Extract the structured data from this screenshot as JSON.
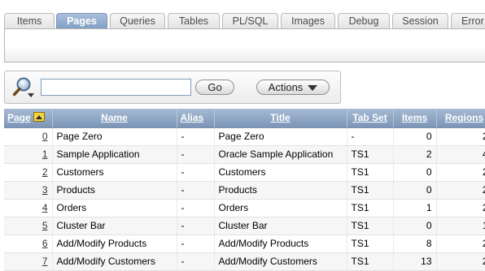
{
  "tabs": [
    {
      "label": "Items",
      "active": false
    },
    {
      "label": "Pages",
      "active": true
    },
    {
      "label": "Queries",
      "active": false
    },
    {
      "label": "Tables",
      "active": false
    },
    {
      "label": "PL/SQL",
      "active": false
    },
    {
      "label": "Images",
      "active": false
    },
    {
      "label": "Debug",
      "active": false
    },
    {
      "label": "Session",
      "active": false
    },
    {
      "label": "Error",
      "active": false
    }
  ],
  "search": {
    "value": "",
    "go_label": "Go",
    "actions_label": "Actions"
  },
  "icons": {
    "search": "magnifier-with-dropdown-icon",
    "sort": "sort-ascending-icon",
    "actions_caret": "chevron-down-icon"
  },
  "colors": {
    "header_bg": "#8ba3c3",
    "active_tab": "#8fa9cc",
    "sort_icon": "#f2d43a"
  },
  "report": {
    "columns": [
      "Page",
      "Name",
      "Alias",
      "Title",
      "Tab Set",
      "Items",
      "Regions"
    ],
    "rows": [
      [
        "0",
        "Page Zero",
        "-",
        "Page Zero",
        "-",
        "0",
        "2"
      ],
      [
        "1",
        "Sample Application",
        "-",
        "Oracle Sample Application",
        "TS1",
        "2",
        "4"
      ],
      [
        "2",
        "Customers",
        "-",
        "Customers",
        "TS1",
        "0",
        "2"
      ],
      [
        "3",
        "Products",
        "-",
        "Products",
        "TS1",
        "0",
        "2"
      ],
      [
        "4",
        "Orders",
        "-",
        "Orders",
        "TS1",
        "1",
        "2"
      ],
      [
        "5",
        "Cluster Bar",
        "-",
        "Cluster Bar",
        "TS1",
        "0",
        "1"
      ],
      [
        "6",
        "Add/Modify Products",
        "-",
        "Add/Modify Products",
        "TS1",
        "8",
        "2"
      ],
      [
        "7",
        "Add/Modify Customers",
        "-",
        "Add/Modify Customers",
        "TS1",
        "13",
        "2"
      ]
    ]
  }
}
